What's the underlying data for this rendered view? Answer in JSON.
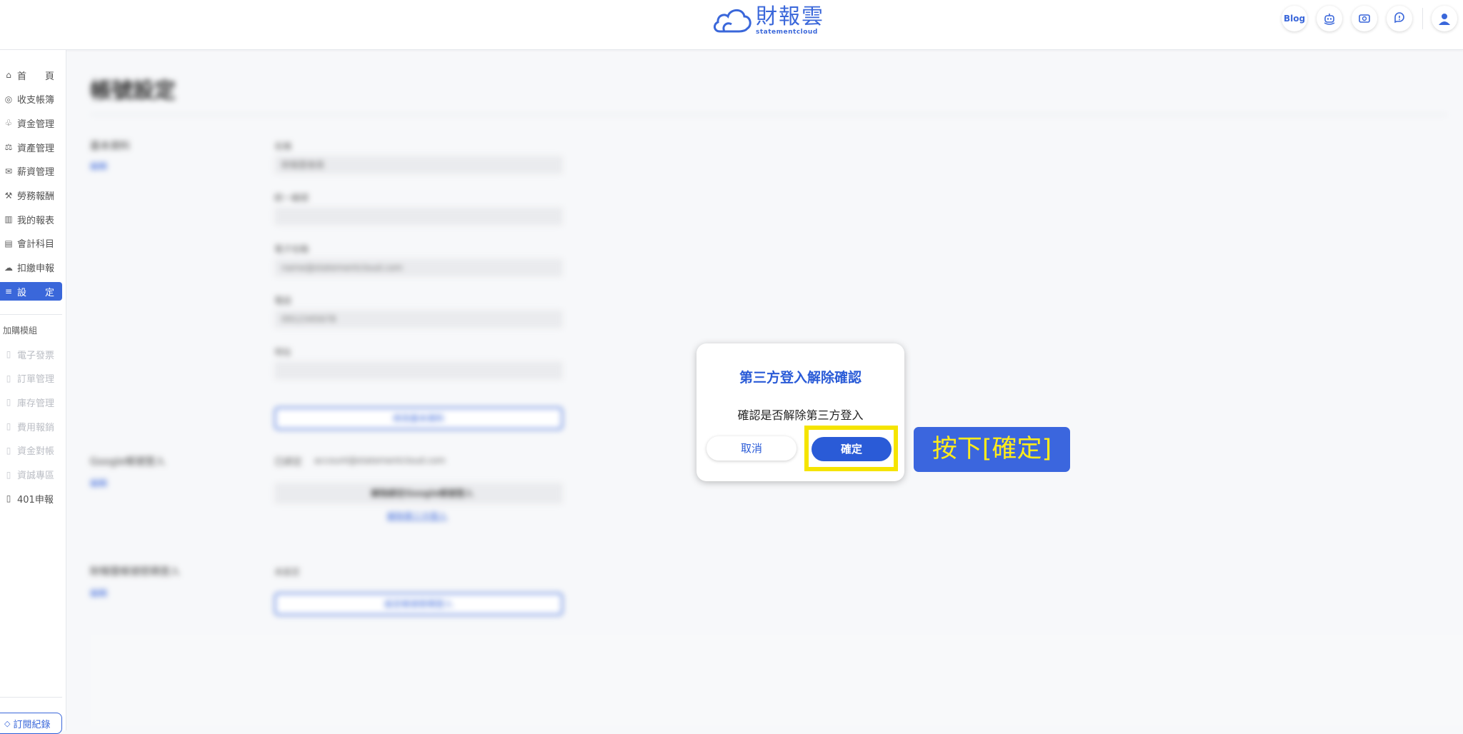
{
  "header": {
    "logo_main": "財報雲",
    "logo_sub": "statementcloud",
    "blog_label": "Blog",
    "icons": [
      "robot-icon",
      "money-icon",
      "help-icon",
      "user-icon"
    ]
  },
  "sidebar": {
    "items": [
      {
        "label": "首　　頁",
        "icon": "home-icon",
        "glyph": "⌂"
      },
      {
        "label": "收支帳簿",
        "icon": "coin-icon",
        "glyph": "◎"
      },
      {
        "label": "資金管理",
        "icon": "hand-coin-icon",
        "glyph": "♧"
      },
      {
        "label": "資產管理",
        "icon": "scale-icon",
        "glyph": "⚖"
      },
      {
        "label": "薪資管理",
        "icon": "envelope-icon",
        "glyph": "✉"
      },
      {
        "label": "勞務報酬",
        "icon": "tools-icon",
        "glyph": "⚒"
      },
      {
        "label": "我的報表",
        "icon": "bar-chart-icon",
        "glyph": "▥"
      },
      {
        "label": "會計科目",
        "icon": "ledger-icon",
        "glyph": "▤"
      },
      {
        "label": "扣繳申報",
        "icon": "cloud-icon",
        "glyph": "☁"
      },
      {
        "label": "設　　定",
        "icon": "sliders-icon",
        "glyph": "≡"
      }
    ],
    "addon_title": "加購模組",
    "addons": [
      {
        "label": "電子發票",
        "icon": "module-icon"
      },
      {
        "label": "訂單管理",
        "icon": "module-icon"
      },
      {
        "label": "庫存管理",
        "icon": "module-icon"
      },
      {
        "label": "費用報銷",
        "icon": "module-icon"
      },
      {
        "label": "資金對帳",
        "icon": "module-icon"
      },
      {
        "label": "資誠專區",
        "icon": "module-icon"
      },
      {
        "label": "401申報",
        "icon": "module-icon"
      }
    ],
    "subscription_label": "訂閱紀錄"
  },
  "page": {
    "title": "帳號設定",
    "sec1_label": "基本資料",
    "sec1_link": "編輯",
    "field_labels": [
      "名稱",
      "統一編號",
      "電子信箱",
      "電話",
      "地址"
    ],
    "field_values": [
      "財報雲會員",
      "",
      "name@statementcloud.com",
      "0912345678",
      ""
    ],
    "sec1_button": "修改基本資料",
    "sec2_label": "Google帳號登入",
    "sec2_link": "編輯",
    "sec2_status": "已綁定",
    "sec2_email": "account@statementcloud.com",
    "sec2_button": "解除綁定Google帳號登入",
    "sec2_small_link": "解除第三方登入",
    "sec3_label": "財報雲帳號密碼登入",
    "sec3_link": "編輯",
    "sec3_status": "未設定",
    "sec3_button": "設定帳號密碼登入"
  },
  "dialog": {
    "title": "第三方登入解除確認",
    "message": "確認是否解除第三方登入",
    "cancel_label": "取消",
    "confirm_label": "確定"
  },
  "annotation": {
    "text": "按下[確定]",
    "highlight_color": "#f5e400",
    "box_color": "#3b66de",
    "text_color": "#ffec1a"
  },
  "colors": {
    "accent": "#2a5bd7"
  }
}
